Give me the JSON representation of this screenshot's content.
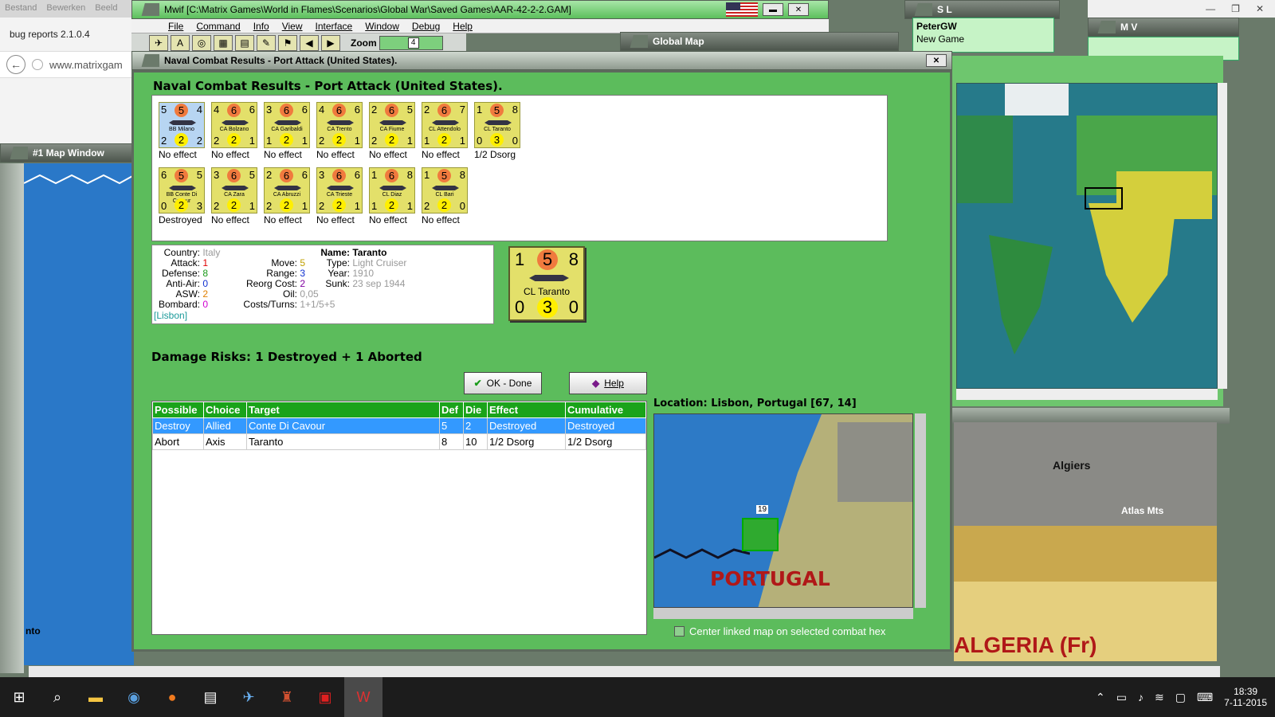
{
  "browser": {
    "menu": [
      "Bestand",
      "Bewerken",
      "Beeld"
    ],
    "tab_title": "bug reports 2.1.0.4",
    "url": "www.matrixgam"
  },
  "main_window": {
    "title": "Mwif [C:\\Matrix Games\\World in Flames\\Scenarios\\Global War\\Saved Games\\AAR-42-2-2.GAM]",
    "menu": [
      "File",
      "Command",
      "Info",
      "View",
      "Interface",
      "Window",
      "Debug",
      "Help"
    ],
    "zoom_label": "Zoom",
    "zoom_value": "4"
  },
  "windows": {
    "global_map": "Global Map",
    "map_window": "#1 Map Window",
    "sl_title": "S L",
    "mv_title": "M V",
    "player": "PeterGW",
    "game": "New Game",
    "left_map_label": "nto"
  },
  "dialog": {
    "title_bar": "Naval Combat Results - Port Attack (United States).",
    "heading": "Naval Combat Results - Port Attack (United States).",
    "damage_risks": "Damage Risks:  1 Destroyed + 1 Aborted",
    "ok_label": "OK - Done",
    "help_label": "Help",
    "location": "Location:  Lisbon, Portugal [67, 14]",
    "center_checkbox": "Center linked map on selected combat hex",
    "center_checked": false
  },
  "units": [
    {
      "atk": "5",
      "mid": "5",
      "def": "4",
      "name": "BB Milano",
      "aa": "2",
      "rng": "2",
      "asw": "2",
      "result": "No effect",
      "selected": true
    },
    {
      "atk": "4",
      "mid": "6",
      "def": "6",
      "name": "CA Bolzano",
      "aa": "2",
      "rng": "2",
      "asw": "1",
      "result": "No effect"
    },
    {
      "atk": "3",
      "mid": "6",
      "def": "6",
      "name": "CA Garibaldi",
      "aa": "1",
      "rng": "2",
      "asw": "1",
      "result": "No effect"
    },
    {
      "atk": "4",
      "mid": "6",
      "def": "6",
      "name": "CA Trento",
      "aa": "2",
      "rng": "2",
      "asw": "1",
      "result": "No effect"
    },
    {
      "atk": "2",
      "mid": "6",
      "def": "5",
      "name": "CA Fiume",
      "aa": "2",
      "rng": "2",
      "asw": "1",
      "result": "No effect"
    },
    {
      "atk": "2",
      "mid": "6",
      "def": "7",
      "name": "CL Attendolo",
      "aa": "1",
      "rng": "2",
      "asw": "1",
      "result": "No effect"
    },
    {
      "atk": "1",
      "mid": "5",
      "def": "8",
      "name": "CL Taranto",
      "aa": "0",
      "rng": "3",
      "asw": "0",
      "result": "1/2 Dsorg"
    },
    {
      "atk": "6",
      "mid": "5",
      "def": "5",
      "name": "BB Conte Di Cavour",
      "aa": "0",
      "rng": "2",
      "asw": "3",
      "result": "Destroyed"
    },
    {
      "atk": "3",
      "mid": "6",
      "def": "5",
      "name": "CA Zara",
      "aa": "2",
      "rng": "2",
      "asw": "1",
      "result": "No effect"
    },
    {
      "atk": "2",
      "mid": "6",
      "def": "6",
      "name": "CA Abruzzi",
      "aa": "2",
      "rng": "2",
      "asw": "1",
      "result": "No effect"
    },
    {
      "atk": "3",
      "mid": "6",
      "def": "6",
      "name": "CA Trieste",
      "aa": "2",
      "rng": "2",
      "asw": "1",
      "result": "No effect"
    },
    {
      "atk": "1",
      "mid": "6",
      "def": "8",
      "name": "CL Diaz",
      "aa": "1",
      "rng": "2",
      "asw": "1",
      "result": "No effect"
    },
    {
      "atk": "1",
      "mid": "5",
      "def": "8",
      "name": "CL Bari",
      "aa": "2",
      "rng": "2",
      "asw": "0",
      "result": "No effect"
    }
  ],
  "info": {
    "labels": {
      "country": "Country:",
      "attack": "Attack:",
      "defense": "Defense:",
      "antiair": "Anti-Air:",
      "asw": "ASW:",
      "bombard": "Bombard:",
      "move": "Move:",
      "range": "Range:",
      "reorg": "Reorg Cost:",
      "oil": "Oil:",
      "costs": "Costs/Turns:",
      "name": "Name:",
      "type": "Type:",
      "year": "Year:",
      "sunk": "Sunk:"
    },
    "country": "Italy",
    "attack": "1",
    "defense": "8",
    "antiair": "0",
    "asw": "2",
    "bombard": "0",
    "location": "[Lisbon]",
    "move": "5",
    "range": "3",
    "reorg": "2",
    "oil": "0,05",
    "costs": "1+1/5+5",
    "name": "Taranto",
    "type": "Light Cruiser",
    "year": "1910",
    "sunk": "23 sep 1944",
    "colors": {
      "attack": "#e00000",
      "defense": "#1a9a1a",
      "antiair": "#1030d0",
      "asw": "#e08000",
      "bombard": "#d000d0",
      "move": "#c0a000",
      "range": "#1030d0",
      "reorg": "#8000a0",
      "muted": "#999999",
      "location": "#1a9a9a"
    }
  },
  "big_counter": {
    "atk": "1",
    "mid": "5",
    "def": "8",
    "name": "CL Taranto",
    "aa": "0",
    "rng": "3",
    "asw": "0"
  },
  "table": {
    "headers": [
      "Possible",
      "Choice",
      "Target",
      "Def",
      "Die",
      "Effect",
      "Cumulative"
    ],
    "rows": [
      [
        "Destroy",
        "Allied",
        "Conte Di Cavour",
        "5",
        "2",
        "Destroyed",
        "Destroyed"
      ],
      [
        "Abort",
        "Axis",
        "Taranto",
        "8",
        "10",
        "1/2 Dsorg",
        "1/2 Dsorg"
      ]
    ]
  },
  "mini_map": {
    "country_label": "PORTUGAL",
    "stack_count": "19"
  },
  "right_map": {
    "city": "Algiers",
    "mountains": "Atlas Mts",
    "country": "ALGERIA (Fr)"
  },
  "taskbar": {
    "time": "18:39",
    "date": "7-11-2015"
  }
}
